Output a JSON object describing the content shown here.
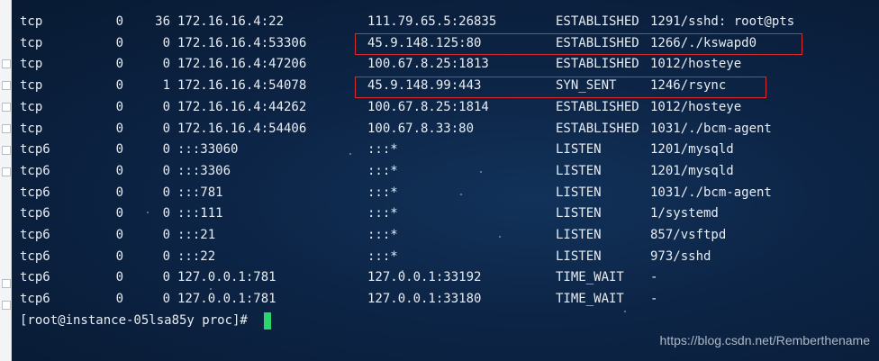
{
  "terminal": {
    "rows": [
      {
        "proto": "tcp",
        "recvq": "0",
        "sendq": "36",
        "local": "172.16.16.4:22",
        "foreign": "111.79.65.5:26835",
        "state": "ESTABLISHED",
        "pid": "1291/sshd: root@pts"
      },
      {
        "proto": "tcp",
        "recvq": "0",
        "sendq": "0",
        "local": "172.16.16.4:53306",
        "foreign": "45.9.148.125:80",
        "state": "ESTABLISHED",
        "pid": "1266/./kswapd0"
      },
      {
        "proto": "tcp",
        "recvq": "0",
        "sendq": "0",
        "local": "172.16.16.4:47206",
        "foreign": "100.67.8.25:1813",
        "state": "ESTABLISHED",
        "pid": "1012/hosteye"
      },
      {
        "proto": "tcp",
        "recvq": "0",
        "sendq": "1",
        "local": "172.16.16.4:54078",
        "foreign": "45.9.148.99:443",
        "state": "SYN_SENT",
        "pid": "1246/rsync"
      },
      {
        "proto": "tcp",
        "recvq": "0",
        "sendq": "0",
        "local": "172.16.16.4:44262",
        "foreign": "100.67.8.25:1814",
        "state": "ESTABLISHED",
        "pid": "1012/hosteye"
      },
      {
        "proto": "tcp",
        "recvq": "0",
        "sendq": "0",
        "local": "172.16.16.4:54406",
        "foreign": "100.67.8.33:80",
        "state": "ESTABLISHED",
        "pid": "1031/./bcm-agent"
      },
      {
        "proto": "tcp6",
        "recvq": "0",
        "sendq": "0",
        "local": ":::33060",
        "foreign": ":::*",
        "state": "LISTEN",
        "pid": "1201/mysqld"
      },
      {
        "proto": "tcp6",
        "recvq": "0",
        "sendq": "0",
        "local": ":::3306",
        "foreign": ":::*",
        "state": "LISTEN",
        "pid": "1201/mysqld"
      },
      {
        "proto": "tcp6",
        "recvq": "0",
        "sendq": "0",
        "local": ":::781",
        "foreign": ":::*",
        "state": "LISTEN",
        "pid": "1031/./bcm-agent"
      },
      {
        "proto": "tcp6",
        "recvq": "0",
        "sendq": "0",
        "local": ":::111",
        "foreign": ":::*",
        "state": "LISTEN",
        "pid": "1/systemd"
      },
      {
        "proto": "tcp6",
        "recvq": "0",
        "sendq": "0",
        "local": ":::21",
        "foreign": ":::*",
        "state": "LISTEN",
        "pid": "857/vsftpd"
      },
      {
        "proto": "tcp6",
        "recvq": "0",
        "sendq": "0",
        "local": ":::22",
        "foreign": ":::*",
        "state": "LISTEN",
        "pid": "973/sshd"
      },
      {
        "proto": "tcp6",
        "recvq": "0",
        "sendq": "0",
        "local": "127.0.0.1:781",
        "foreign": "127.0.0.1:33192",
        "state": "TIME_WAIT",
        "pid": "-"
      },
      {
        "proto": "tcp6",
        "recvq": "0",
        "sendq": "0",
        "local": "127.0.0.1:781",
        "foreign": "127.0.0.1:33180",
        "state": "TIME_WAIT",
        "pid": "-"
      }
    ],
    "prompt": "[root@instance-05lsa85y proc]# ",
    "highlight_color": "#d92b2b",
    "cursor_color": "#2bd66a"
  },
  "watermark": "https://blog.csdn.net/Remberthename"
}
